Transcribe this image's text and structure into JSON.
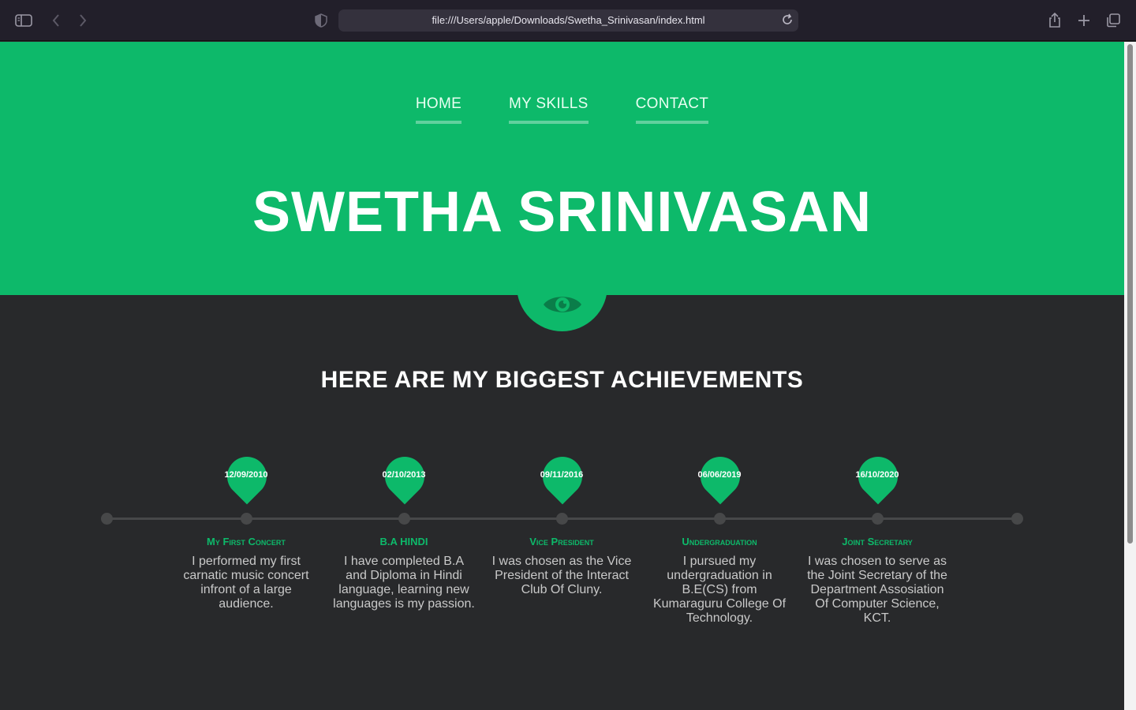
{
  "browser": {
    "url": "file:///Users/apple/Downloads/Swetha_Srinivasan/index.html"
  },
  "nav": {
    "items": [
      "HOME",
      "MY SKILLS",
      "CONTACT"
    ]
  },
  "hero": {
    "title": "SWETHA SRINIVASAN"
  },
  "achievements": {
    "title": "HERE ARE MY BIGGEST ACHIEVEMENTS",
    "events": [
      {
        "date": "12/09/2010",
        "title": "My First Concert",
        "desc": "I performed my first carnatic music concert infront of a large audience."
      },
      {
        "date": "02/10/2013",
        "title": "B.A HINDI",
        "desc": "I have completed B.A and Diploma in Hindi language, learning new languages is my passion."
      },
      {
        "date": "09/11/2016",
        "title": "Vice President",
        "desc": "I was chosen as the Vice President of the Interact Club Of Cluny."
      },
      {
        "date": "06/06/2019",
        "title": "Undergraduation",
        "desc": "I pursued my undergraduation in B.E(CS) from Kumaraguru College Of Technology."
      },
      {
        "date": "16/10/2020",
        "title": "Joint Secretary",
        "desc": "I was chosen to serve as the Joint Secretary of the Department Assosiation Of Computer Science, KCT."
      }
    ]
  },
  "colors": {
    "accent": "#0db96a",
    "background": "#28292b"
  },
  "icons": [
    "sidebar-icon",
    "back-icon",
    "forward-icon",
    "shield-icon",
    "reload-icon",
    "share-icon",
    "new-tab-icon",
    "tabs-icon",
    "eye-icon"
  ]
}
